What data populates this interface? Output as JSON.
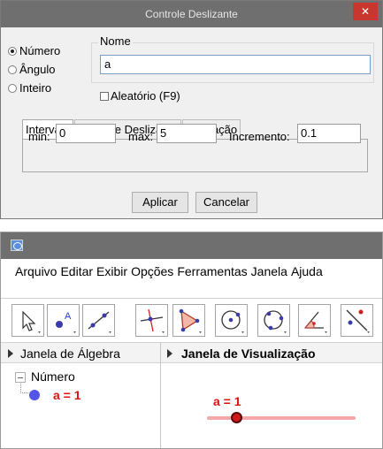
{
  "dialog": {
    "title": "Controle Deslizante",
    "close_glyph": "✕",
    "type_options": [
      {
        "label": "Número",
        "selected": true
      },
      {
        "label": "Ângulo",
        "selected": false
      },
      {
        "label": "Inteiro",
        "selected": false
      }
    ],
    "name_label": "Nome",
    "name_value": "a",
    "random_label": "Aleatório (F9)",
    "random_checked": false,
    "tabs": [
      {
        "label": "Intervalo",
        "active": true
      },
      {
        "label": "Controle Deslizante",
        "active": false
      },
      {
        "label": "Animação",
        "active": false
      }
    ],
    "min_label": "min:",
    "min_value": "0",
    "max_label": "max:",
    "max_value": "5",
    "increment_label": "Incremento:",
    "increment_value": "0.1",
    "apply_label": "Aplicar",
    "cancel_label": "Cancelar"
  },
  "app": {
    "menu": [
      "Arquivo",
      "Editar",
      "Exibir",
      "Opções",
      "Ferramentas",
      "Janela",
      "Ajuda"
    ],
    "tools": [
      {
        "icon": "move-pointer-icon"
      },
      {
        "icon": "new-point-icon",
        "glyph_label": "A"
      },
      {
        "icon": "line-through-two-points-icon"
      },
      {
        "icon": "perpendicular-line-icon"
      },
      {
        "icon": "polygon-icon"
      },
      {
        "icon": "circle-center-point-icon"
      },
      {
        "icon": "circle-three-points-icon"
      },
      {
        "icon": "angle-icon"
      },
      {
        "icon": "reflect-about-line-icon"
      }
    ],
    "algebra_title": "Janela de Álgebra",
    "graphics_title": "Janela de Visualização",
    "algebra_category": "Número",
    "algebra_object": "a = 1",
    "slider_label": "a = 1",
    "slider_fraction": 0.2,
    "colors": {
      "object_red": "#e01010",
      "object_dot": "#5454e8",
      "slider_track": "#f4a7a7",
      "titlebar": "#6f6f6f",
      "close_button": "#c7372f"
    }
  }
}
